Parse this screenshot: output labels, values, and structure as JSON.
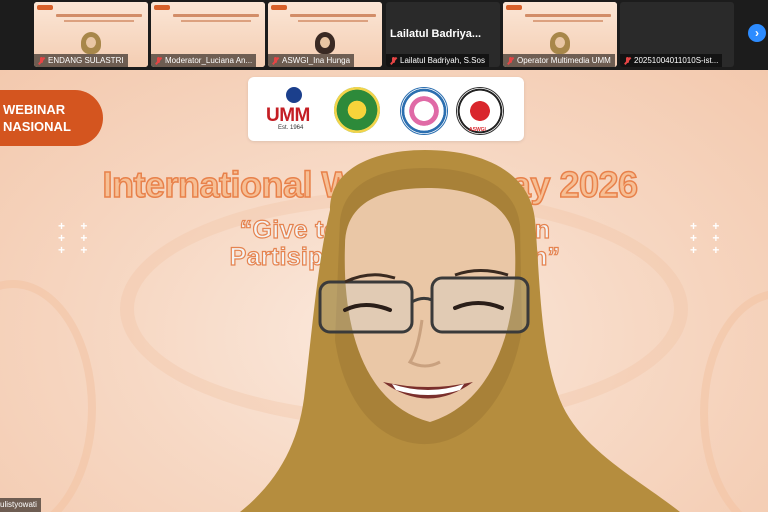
{
  "participants": [
    {
      "name": "ENDANG SULASTRI",
      "muted": true,
      "type": "video"
    },
    {
      "name": "Moderator_Luciana An...",
      "muted": true,
      "type": "video"
    },
    {
      "name": "ASWGI_Ina Hunga",
      "muted": true,
      "type": "video"
    },
    {
      "name": "Lailatul Badriyah, S.Sos",
      "display": "Lailatul Badriya...",
      "muted": true,
      "type": "name-only"
    },
    {
      "name": "Operator Multimedia UMM",
      "muted": true,
      "type": "video"
    },
    {
      "name": "20251004011010S-ist...",
      "muted": true,
      "type": "blank"
    }
  ],
  "strip": {
    "next_icon": "chevron-right-icon",
    "next_glyph": "›",
    "accent": "#2d8cff"
  },
  "slide": {
    "badge": {
      "line1": "WEBINAR",
      "line2": "NASIONAL",
      "color": "#d4551f"
    },
    "logos": {
      "umm_text": "UMM",
      "umm_est": "Est. 1964",
      "aswgi": "ASWGI"
    },
    "title": "International Women's Day 2026",
    "theme_line1": "“Give to Gain: ...kses dan",
    "theme_line2": "Partisipasi Be... ...empuan”",
    "sparkle_glyph": "+ +",
    "accent": "#e8814a"
  },
  "self_view": {
    "label": "ulistyowati"
  }
}
